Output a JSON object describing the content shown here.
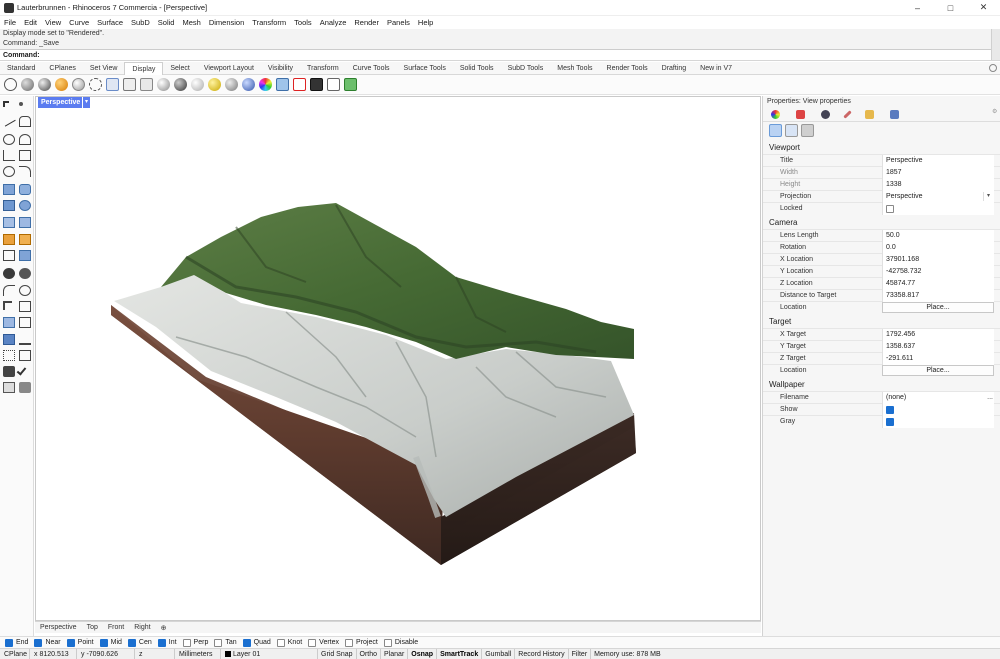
{
  "window": {
    "title": "Lauterbrunnen - Rhinoceros 7 Commercia - [Perspective]",
    "minimize": "–",
    "maximize": "□",
    "close": "✕"
  },
  "menu": [
    "File",
    "Edit",
    "View",
    "Curve",
    "Surface",
    "SubD",
    "Solid",
    "Mesh",
    "Dimension",
    "Transform",
    "Tools",
    "Analyze",
    "Render",
    "Panels",
    "Help"
  ],
  "command_history": [
    "Display mode set to \"Rendered\".",
    "Command: _Save"
  ],
  "command_prompt": "Command:",
  "tabs": [
    "Standard",
    "CPlanes",
    "Set View",
    "Display",
    "Select",
    "Viewport Layout",
    "Visibility",
    "Transform",
    "Curve Tools",
    "Surface Tools",
    "Solid Tools",
    "SubD Tools",
    "Mesh Tools",
    "Render Tools",
    "Drafting",
    "New in V7"
  ],
  "active_tab": "Display",
  "viewport": {
    "label": "Perspective",
    "dropdown": "▾"
  },
  "viewport_tabs": [
    "Perspective",
    "Top",
    "Front",
    "Right",
    "⊕"
  ],
  "osnaps": [
    {
      "label": "End",
      "checked": true
    },
    {
      "label": "Near",
      "checked": true
    },
    {
      "label": "Point",
      "checked": true
    },
    {
      "label": "Mid",
      "checked": true
    },
    {
      "label": "Cen",
      "checked": true
    },
    {
      "label": "Int",
      "checked": true
    },
    {
      "label": "Perp",
      "checked": false
    },
    {
      "label": "Tan",
      "checked": false
    },
    {
      "label": "Quad",
      "checked": true
    },
    {
      "label": "Knot",
      "checked": false
    },
    {
      "label": "Vertex",
      "checked": false
    },
    {
      "label": "Project",
      "checked": false
    },
    {
      "label": "Disable",
      "checked": false
    }
  ],
  "status": {
    "cplane": "CPlane",
    "x": "x 8120.513",
    "y": "y -7090.626",
    "z": "z",
    "units": "Millimeters",
    "layer": "Layer 01",
    "grid_snap": "Grid Snap",
    "ortho": "Ortho",
    "planar": "Planar",
    "osnap": "Osnap",
    "smarttrack": "SmartTrack",
    "gumball": "Gumball",
    "record_history": "Record History",
    "filter": "Filter",
    "memory": "Memory use: 878 MB"
  },
  "properties": {
    "title": "Properties: View properties",
    "sections": {
      "viewport": {
        "heading": "Viewport",
        "rows": [
          {
            "label": "Title",
            "value": "Perspective"
          },
          {
            "label": "Width",
            "value": "1857"
          },
          {
            "label": "Height",
            "value": "1338"
          },
          {
            "label": "Projection",
            "value": "Perspective"
          },
          {
            "label": "Locked",
            "value": ""
          }
        ]
      },
      "camera": {
        "heading": "Camera",
        "rows": [
          {
            "label": "Lens Length",
            "value": "50.0"
          },
          {
            "label": "Rotation",
            "value": "0.0"
          },
          {
            "label": "X Location",
            "value": "37901.168"
          },
          {
            "label": "Y Location",
            "value": "-42758.732"
          },
          {
            "label": "Z Location",
            "value": "45874.77"
          },
          {
            "label": "Distance to Target",
            "value": "73358.817"
          },
          {
            "label": "Location",
            "value": "Place..."
          }
        ]
      },
      "target": {
        "heading": "Target",
        "rows": [
          {
            "label": "X Target",
            "value": "1792.456"
          },
          {
            "label": "Y Target",
            "value": "1358.637"
          },
          {
            "label": "Z Target",
            "value": "-291.611"
          },
          {
            "label": "Location",
            "value": "Place..."
          }
        ]
      },
      "wallpaper": {
        "heading": "Wallpaper",
        "rows": [
          {
            "label": "Filename",
            "value": "(none)",
            "extra": "..."
          },
          {
            "label": "Show",
            "checked": true
          },
          {
            "label": "Gray",
            "checked": true
          }
        ]
      }
    }
  }
}
